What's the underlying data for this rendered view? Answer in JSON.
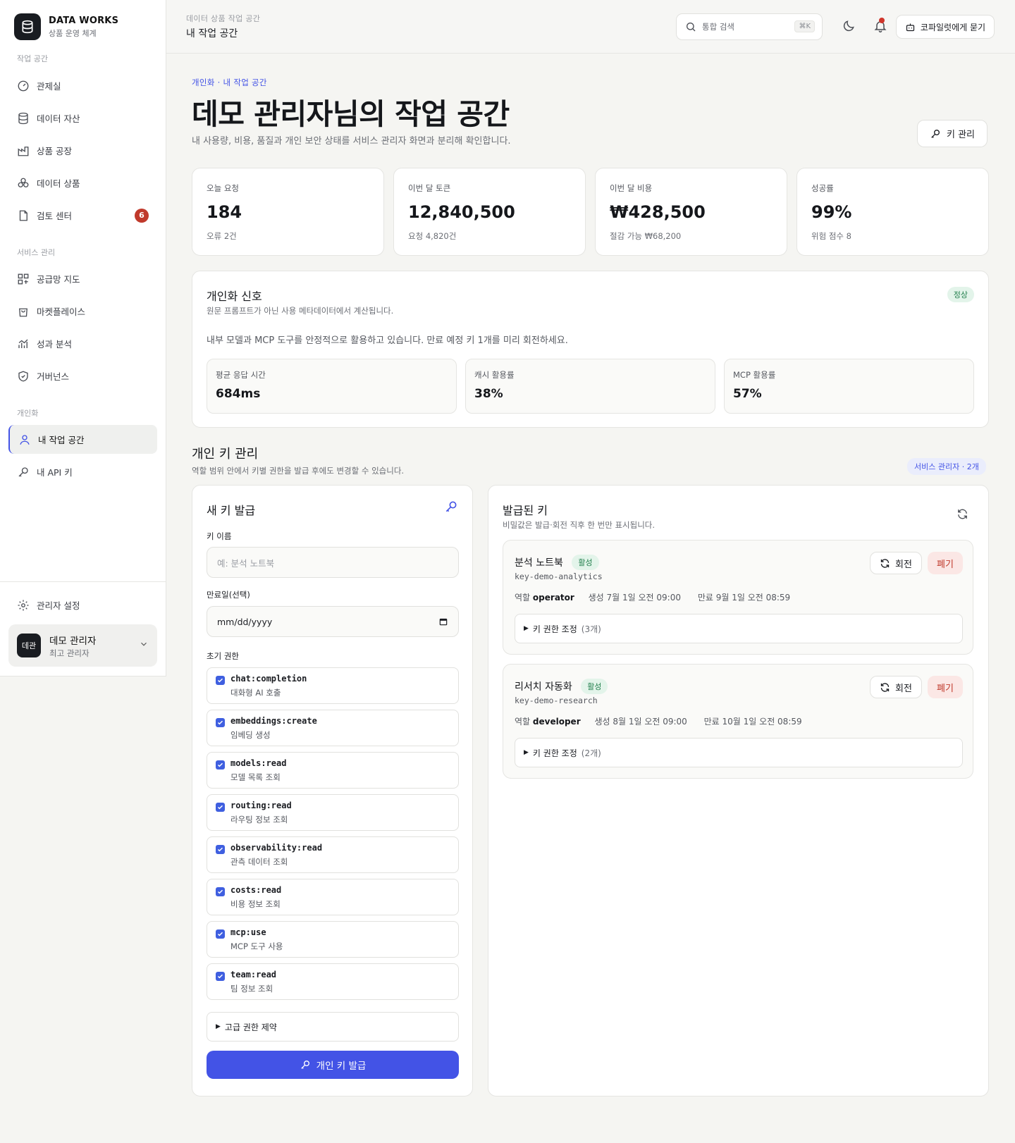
{
  "brand": {
    "name": "DATA WORKS",
    "subtitle": "상품 운영 체계"
  },
  "sidebar": {
    "sections": [
      {
        "title": "작업 공간"
      },
      {
        "title": "서비스 관리"
      },
      {
        "title": "개인화"
      }
    ],
    "items": [
      {
        "label": "관제실",
        "icon": "gauge-icon"
      },
      {
        "label": "데이터 자산",
        "icon": "database-icon"
      },
      {
        "label": "상품 공장",
        "icon": "factory-icon"
      },
      {
        "label": "데이터 상품",
        "icon": "boxes-icon"
      },
      {
        "label": "검토 센터",
        "icon": "document-icon",
        "badge": "6"
      },
      {
        "label": "공급망 지도",
        "icon": "network-icon"
      },
      {
        "label": "마켓플레이스",
        "icon": "shopping-bag-icon"
      },
      {
        "label": "성과 분석",
        "icon": "chart-icon"
      },
      {
        "label": "거버넌스",
        "icon": "shield-icon"
      },
      {
        "label": "내 작업 공간",
        "icon": "user-icon",
        "active": true
      },
      {
        "label": "내 API 키",
        "icon": "key-icon"
      }
    ],
    "settings_label": "관리자 설정",
    "user": {
      "initials": "데관",
      "name": "데모 관리자",
      "role": "최고 관리자"
    }
  },
  "topbar": {
    "crumb": "데이터 상품 작업 공간",
    "title": "내 작업 공간",
    "search_placeholder": "통합 검색",
    "search_shortcut": "⌘K",
    "copilot_label": "코파일럿에게 묻기"
  },
  "hero": {
    "crumb": "개인화 · 내 작업 공간",
    "title": "데모 관리자님의 작업 공간",
    "description": "내 사용량, 비용, 품질과 개인 보안 상태를 서비스 관리자 화면과 분리해 확인합니다.",
    "key_manage_label": "키 관리"
  },
  "stats": [
    {
      "label": "오늘 요청",
      "value": "184",
      "sub": "오류 2건"
    },
    {
      "label": "이번 달 토큰",
      "value": "12,840,500",
      "sub": "요청 4,820건"
    },
    {
      "label": "이번 달 비용",
      "value": "₩428,500",
      "sub": "절감 가능 ₩68,200"
    },
    {
      "label": "성공률",
      "value": "99%",
      "sub": "위험 점수 8"
    }
  ],
  "signal": {
    "title": "개인화 신호",
    "description": "원문 프롬프트가 아닌 사용 메타데이터에서 계산됩니다.",
    "status": "정상",
    "message": "내부 모델과 MCP 도구를 안정적으로 활용하고 있습니다. 만료 예정 키 1개를 미리 회전하세요.",
    "metrics": [
      {
        "label": "평균 응답 시간",
        "value": "684ms"
      },
      {
        "label": "캐시 활용률",
        "value": "38%"
      },
      {
        "label": "MCP 활용률",
        "value": "57%"
      }
    ]
  },
  "keys": {
    "title": "개인 키 관리",
    "description": "역할 범위 안에서 키별 권한을 발급 후에도 변경할 수 있습니다.",
    "scope_badge": "서비스 관리자 · 2개",
    "form": {
      "title": "새 키 발급",
      "name_label": "키 이름",
      "name_placeholder": "예: 분석 노트북",
      "expiry_label": "만료일(선택)",
      "expiry_value": "mm/dd/yyyy",
      "perm_label": "초기 권한",
      "permissions": [
        {
          "code": "chat:completion",
          "desc": "대화형 AI 호출",
          "checked": true
        },
        {
          "code": "embeddings:create",
          "desc": "임베딩 생성",
          "checked": true
        },
        {
          "code": "models:read",
          "desc": "모델 목록 조회",
          "checked": true
        },
        {
          "code": "routing:read",
          "desc": "라우팅 정보 조회",
          "checked": true
        },
        {
          "code": "observability:read",
          "desc": "관측 데이터 조회",
          "checked": true
        },
        {
          "code": "costs:read",
          "desc": "비용 정보 조회",
          "checked": true
        },
        {
          "code": "mcp:use",
          "desc": "MCP 도구 사용",
          "checked": true
        },
        {
          "code": "team:read",
          "desc": "팀 정보 조회",
          "checked": true
        }
      ],
      "advanced_label": "고급 권한 제약",
      "submit_label": "개인 키 발급"
    },
    "issued": {
      "title": "발급된 키",
      "description": "비밀값은 발급·회전 직후 한 번만 표시됩니다.",
      "items": [
        {
          "name": "분석 노트북",
          "status": "활성",
          "id": "key-demo-analytics",
          "role_label": "역할",
          "role": "operator",
          "created": "생성 7월 1일 오전 09:00",
          "expires": "만료 9월 1일 오전 08:59",
          "details_label": "키 권한 조정",
          "details_count": "(3개)",
          "rotate_label": "회전",
          "revoke_label": "폐기"
        },
        {
          "name": "리서치 자동화",
          "status": "활성",
          "id": "key-demo-research",
          "role_label": "역할",
          "role": "developer",
          "created": "생성 8월 1일 오전 09:00",
          "expires": "만료 10월 1일 오전 08:59",
          "details_label": "키 권한 조정",
          "details_count": "(2개)",
          "rotate_label": "회전",
          "revoke_label": "폐기"
        }
      ]
    }
  },
  "colors": {
    "accent": "#4353e6",
    "success_bg": "#e3f4ea",
    "success_text": "#24804e",
    "danger": "#c0392b"
  }
}
